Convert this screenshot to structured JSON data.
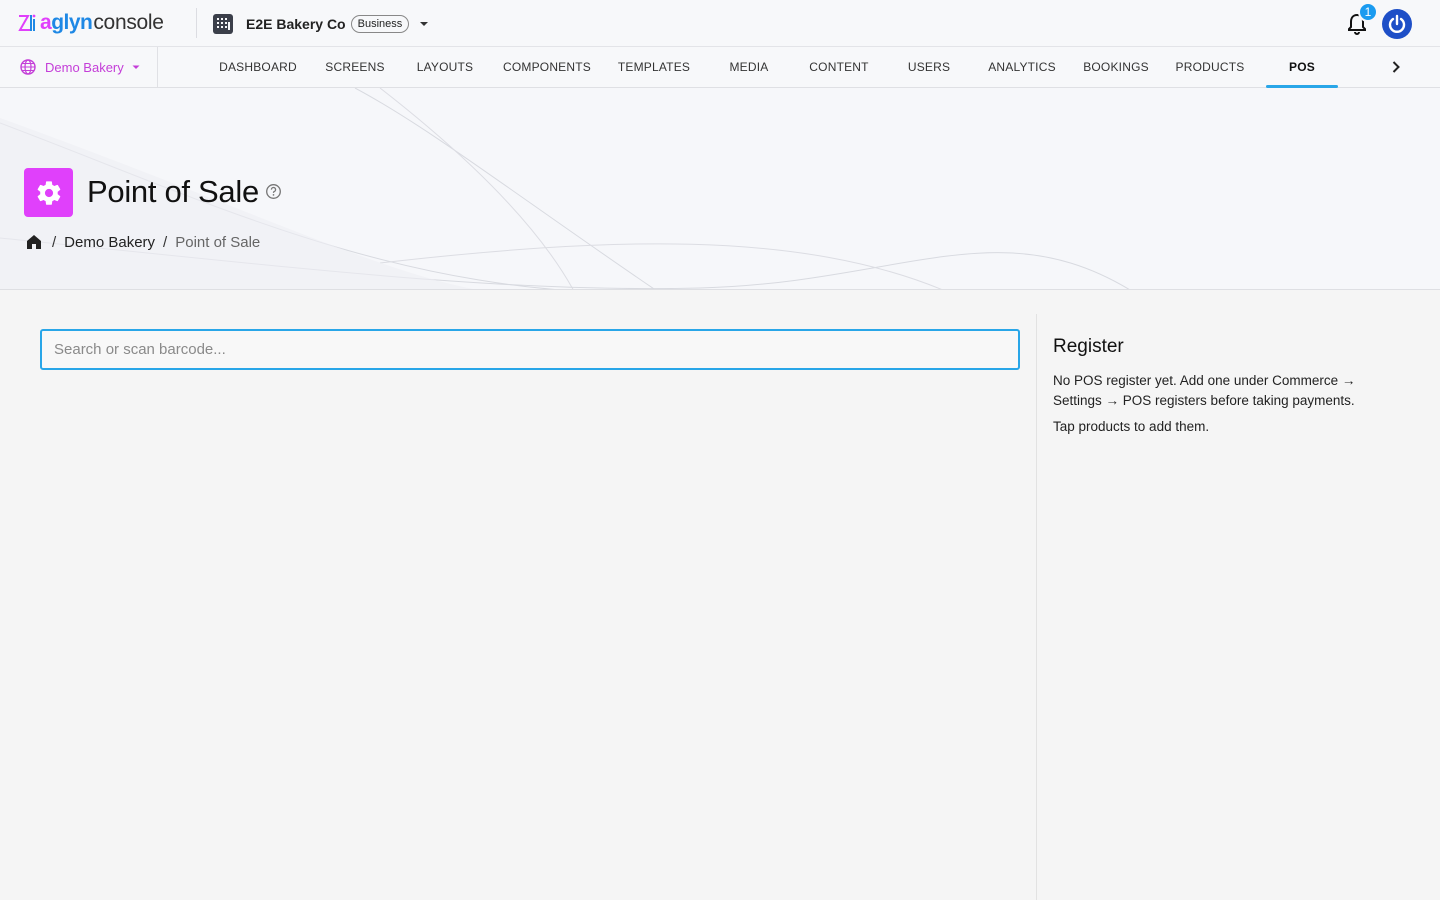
{
  "app": {
    "brand_a": "a",
    "brand_b": "glyn",
    "brand_c": "console"
  },
  "org": {
    "name": "E2E Bakery Co",
    "plan_badge": "Business"
  },
  "notifications": {
    "count": "1"
  },
  "site_selector": {
    "label": "Demo Bakery"
  },
  "nav": {
    "tabs": [
      {
        "label": "DASHBOARD"
      },
      {
        "label": "SCREENS"
      },
      {
        "label": "LAYOUTS"
      },
      {
        "label": "COMPONENTS"
      },
      {
        "label": "TEMPLATES"
      },
      {
        "label": "MEDIA"
      },
      {
        "label": "CONTENT"
      },
      {
        "label": "USERS"
      },
      {
        "label": "ANALYTICS"
      },
      {
        "label": "BOOKINGS"
      },
      {
        "label": "PRODUCTS"
      },
      {
        "label": "POS"
      }
    ],
    "active_tab": "POS"
  },
  "page": {
    "title": "Point of Sale",
    "breadcrumb": [
      "Demo Bakery",
      "Point of Sale"
    ]
  },
  "search": {
    "placeholder": "Search or scan barcode...",
    "value": ""
  },
  "register": {
    "title": "Register",
    "message": "No POS register yet. Add one under Commerce → Settings → POS registers before taking payments.",
    "hint": "Tap products to add them."
  },
  "colors": {
    "accent_magenta": "#e040fb",
    "accent_blue": "#29a6e8",
    "power_blue": "#1e4fc7"
  }
}
